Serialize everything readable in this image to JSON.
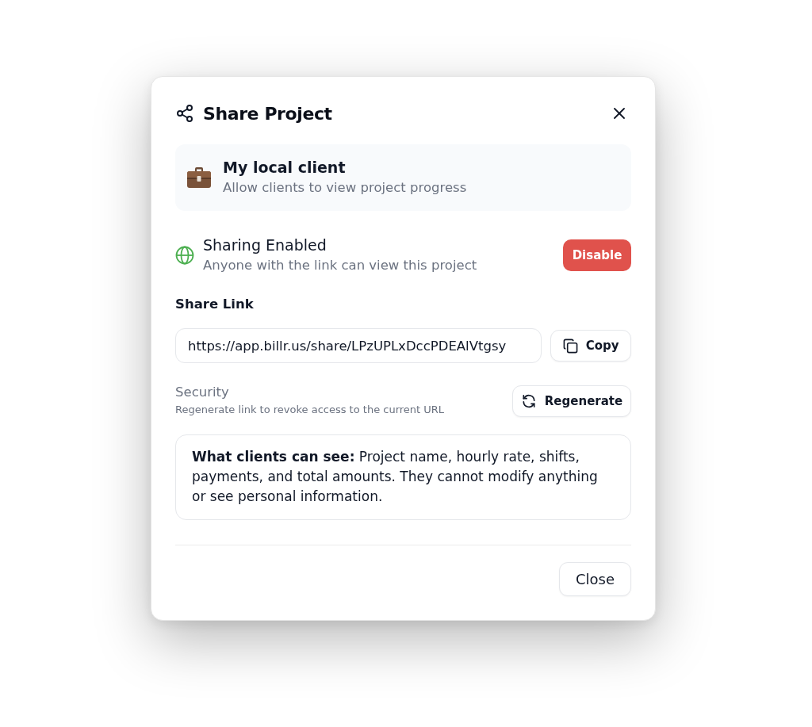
{
  "dialog": {
    "title": "Share Project"
  },
  "client": {
    "name": "My local client",
    "description": "Allow clients to view project progress"
  },
  "sharing": {
    "enabled": true,
    "title": "Sharing Enabled",
    "description": "Anyone with the link can view this project",
    "toggle_button": "Disable"
  },
  "share_link": {
    "label": "Share Link",
    "value": "https://app.billr.us/share/LPzUPLxDccPDEAlVtgsy",
    "copy_button": "Copy"
  },
  "security": {
    "title": "Security",
    "description": "Regenerate link to revoke access to the current URL",
    "regenerate_button": "Regenerate"
  },
  "info_note": "**What clients can see:** Project name, hourly rate, shifts, payments, and total amounts. They cannot modify anything or see personal information.",
  "footer": {
    "close_button": "Close"
  }
}
